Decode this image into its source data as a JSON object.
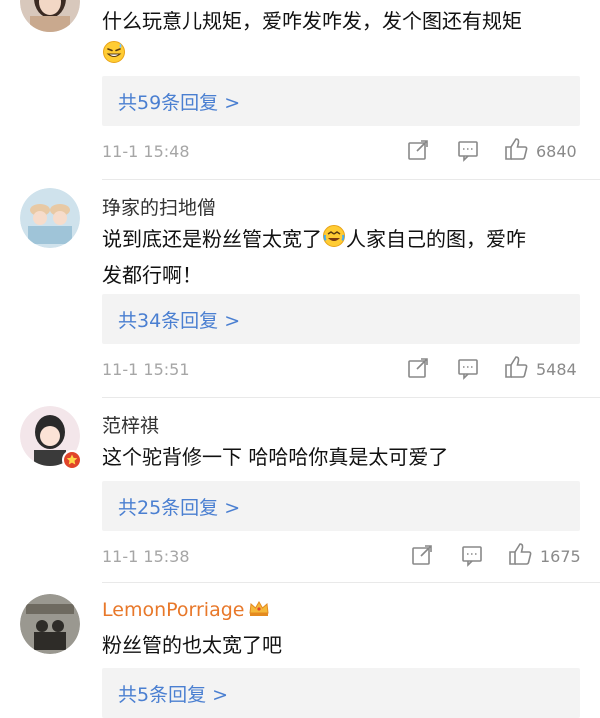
{
  "comments": [
    {
      "username": "",
      "text": "什么玩意儿规矩，爱咋发咋发，发个图还有规矩",
      "emoji_icon": "grinning-sweat-emoji-icon",
      "reply_label": "共59条回复 >",
      "timestamp": "11-1 15:48",
      "likes": "6840"
    },
    {
      "username": "琤家的扫地僧",
      "text_before_emoji": "说到底还是粉丝管太宽了",
      "emoji_icon": "laughing-crying-emoji-icon",
      "text_after_emoji": "人家自己的图，爱咋",
      "text_line2": "发都行啊！",
      "reply_label": "共34条回复 >",
      "timestamp": "11-1 15:51",
      "likes": "5484"
    },
    {
      "username": "范梓祺",
      "text": "这个驼背修一下 哈哈哈你真是太可爱了",
      "badge_icon": "verified-badge-icon",
      "reply_label": "共25条回复 >",
      "timestamp": "11-1 15:38",
      "likes": "1675"
    },
    {
      "username": "LemonPorriage",
      "crown_icon": "crown-icon",
      "text": "粉丝管的也太宽了吧",
      "reply_label": "共5条回复 >"
    }
  ],
  "colors": {
    "link_blue": "#4a7fd1",
    "username_orange": "#e8782a",
    "muted_gray": "#a6a6a6",
    "reply_bg": "#f3f3f3"
  }
}
